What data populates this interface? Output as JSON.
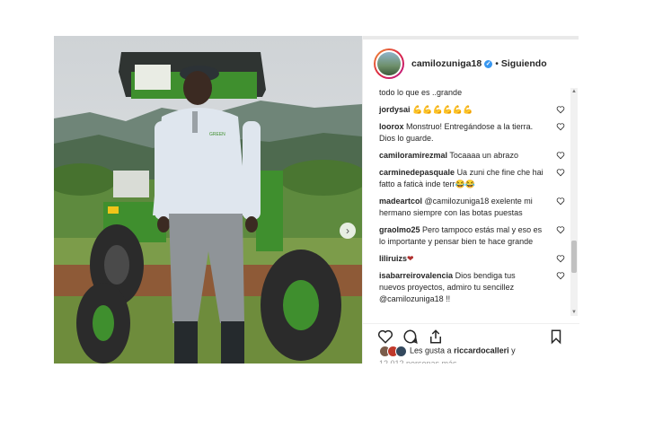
{
  "top_strip_text": "Siguiendo",
  "header": {
    "username": "camilozuniga18",
    "verified_glyph": "✓",
    "separator": "•",
    "follow_status": "Siguiendo"
  },
  "comments": [
    {
      "user": "",
      "text": "todo lo que es ..grande"
    },
    {
      "user": "jordysai",
      "text": "💪💪💪💪💪💪"
    },
    {
      "user": "loorox",
      "text": "Monstruo! Entregándose a la tierra. Dios lo guarde."
    },
    {
      "user": "camiloramirezmal",
      "text": "Tocaaaa un abrazo"
    },
    {
      "user": "carminedepasquale",
      "text": "Ua zuni che fine che hai fatto a faticà inde terr😂😂"
    },
    {
      "user": "madeartcol",
      "text": "@camilozuniga18 exelente mi hermano siempre con las botas puestas"
    },
    {
      "user": "graolmo25",
      "text": "Pero tampoco estás mal y eso es lo importante y pensar bien te hace grande"
    },
    {
      "user": "liliruizs",
      "text": "❤"
    },
    {
      "user": "isabarreirovalencia",
      "text": "Dios bendiga tus nuevos proyectos, admiro tu sencillez @camilozuniga18 !!"
    }
  ],
  "likes": {
    "prefix": "Les gusta a",
    "user": "riccardocalleri",
    "suffix": "y",
    "more": "12.012 personas más"
  },
  "photo": {
    "shirt_logo_text": "GREEN",
    "next_glyph": "›"
  },
  "scrollbar": {
    "up": "▲",
    "down": "▼"
  },
  "icons": [
    "heart-icon",
    "comment-icon",
    "share-icon",
    "bookmark-icon",
    "verified-badge-icon",
    "next-arrow-icon"
  ],
  "colors": {
    "verified": "#3897f0",
    "text": "#262626",
    "tractor_green": "#3f8f2e"
  }
}
